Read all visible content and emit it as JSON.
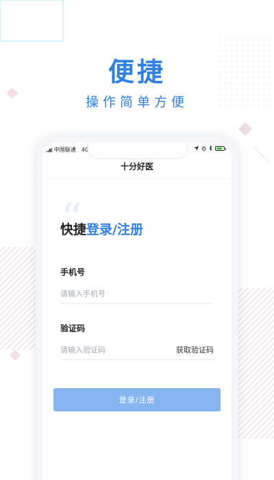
{
  "hero": {
    "title": "便捷",
    "subtitle": "操作简单方便"
  },
  "status_bar": {
    "carrier": "中国联通",
    "network": "4G",
    "battery_level": 0.8,
    "battery_color": "#22c233"
  },
  "app": {
    "title": "十分好医",
    "quote_mark": "“",
    "heading_plain": "快捷",
    "heading_accent": "登录/注册"
  },
  "form": {
    "phone_label": "手机号",
    "phone_placeholder": "请输入手机号",
    "code_label": "验证码",
    "code_placeholder": "请输入验证码",
    "get_code_label": "获取验证码",
    "submit_label": "登录/注册"
  },
  "colors": {
    "accent": "#2f7fe8",
    "button_disabled": "#87b5f4"
  }
}
